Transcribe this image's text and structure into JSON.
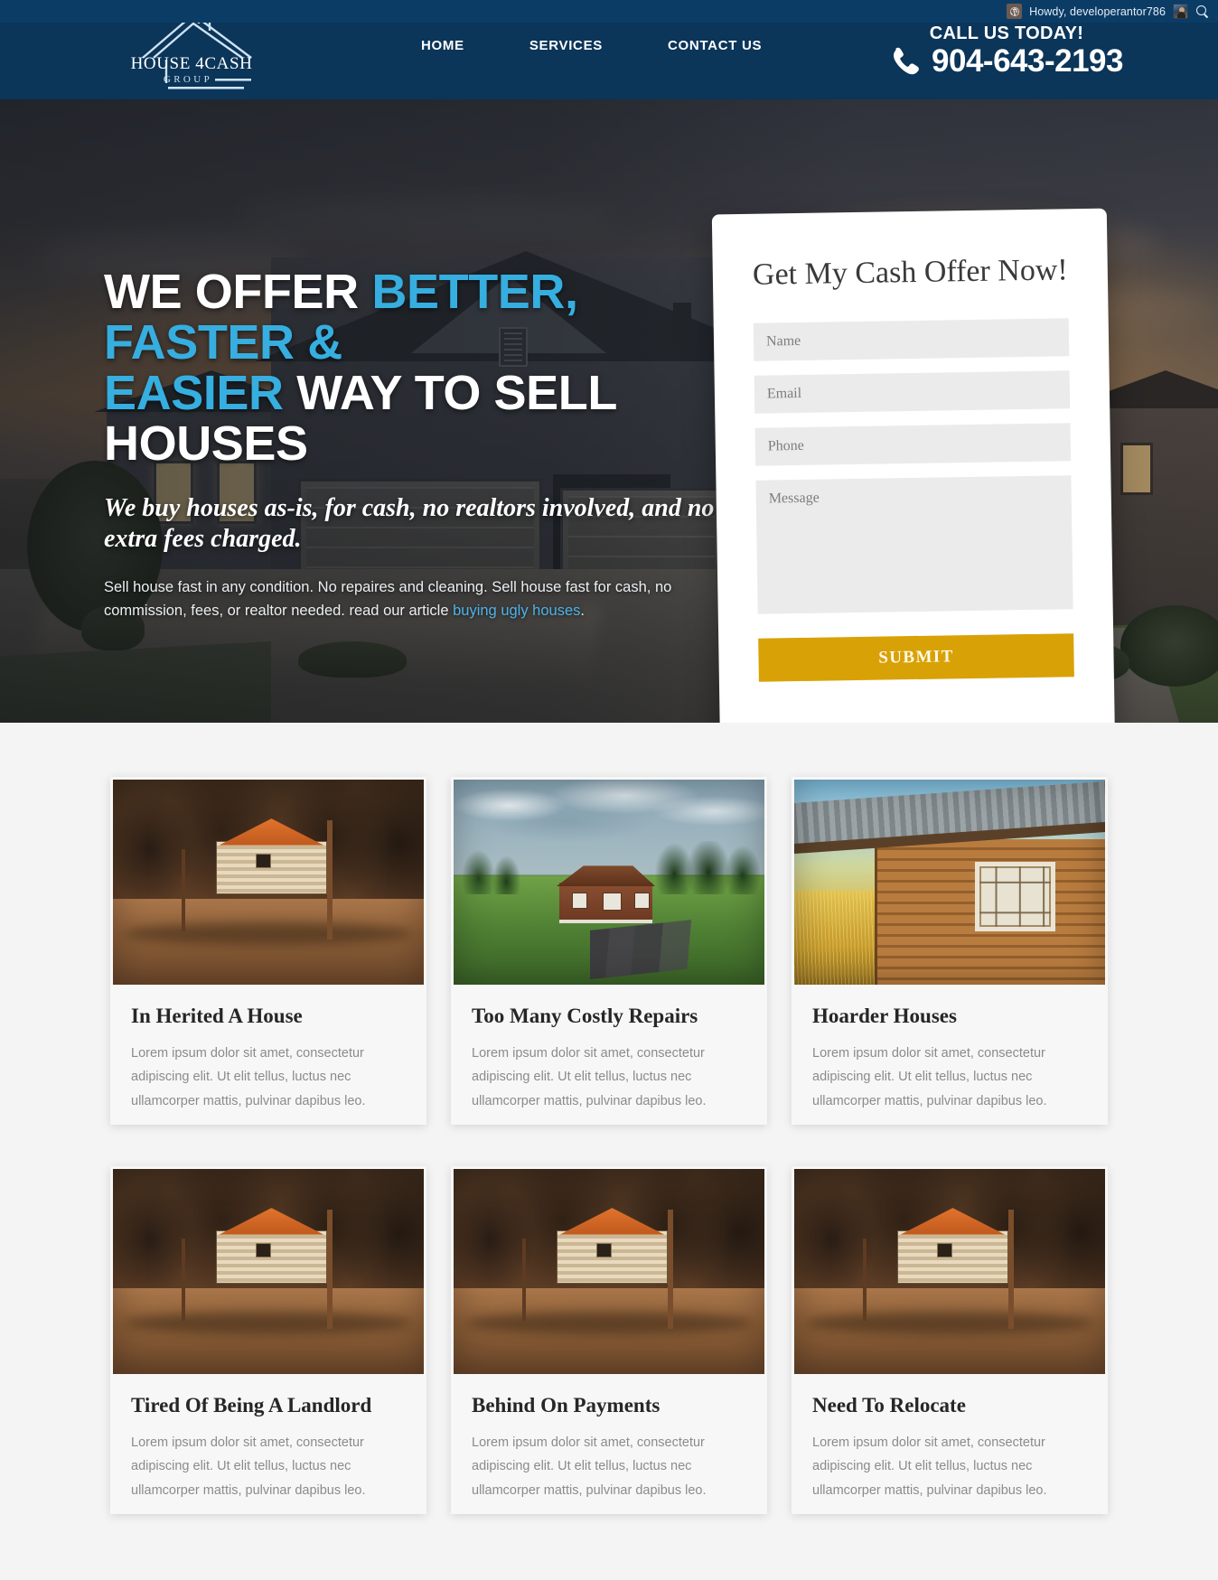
{
  "adminbar": {
    "wp_icon": "wordpress-icon",
    "howdy": "Howdy, developerantor786",
    "avatar": "user-avatar",
    "search_icon": "search-icon"
  },
  "header": {
    "logo": {
      "line1": "HOUSE 4CASH",
      "line2": "GROUP",
      "icon": "house-outline-icon"
    },
    "nav": [
      {
        "label": "HOME"
      },
      {
        "label": "SERVICES"
      },
      {
        "label": "CONTACT US"
      }
    ],
    "call": {
      "label": "CALL US TODAY!",
      "phone_icon": "phone-icon",
      "number": "904-643-2193"
    },
    "colors": {
      "background": "#0b3559",
      "adminbar": "#0b3c66"
    }
  },
  "hero": {
    "headline": {
      "part1": "WE OFFER ",
      "accent1": "BETTER, FASTER &",
      "accent2": "EASIER",
      "part2": " WAY TO SELL HOUSES"
    },
    "subheadline": "We buy houses as-is, for cash, no realtors involved, and no extra fees charged.",
    "paragraph_before": "Sell house fast in any condition. No repaires and cleaning. Sell house fast for cash, no commission, fees, or realtor needed. read our article ",
    "paragraph_link": "buying ugly houses",
    "paragraph_after": ".",
    "colors": {
      "accent": "#36aee0"
    }
  },
  "form": {
    "title": "Get My Cash Offer Now!",
    "fields": [
      {
        "name": "name",
        "placeholder": "Name"
      },
      {
        "name": "email",
        "placeholder": "Email"
      },
      {
        "name": "phone",
        "placeholder": "Phone"
      }
    ],
    "message_placeholder": "Message",
    "submit_label": "SUBMIT",
    "colors": {
      "submit": "#d8a206",
      "field": "#ebebeb"
    }
  },
  "cards": [
    {
      "title": "In Herited A House",
      "text": "Lorem ipsum dolor sit amet, consectetur adipiscing elit. Ut elit tellus, luctus nec ullamcorper mattis, pulvinar dapibus leo.",
      "image": "log-cabin-dirt-road-photo"
    },
    {
      "title": "Too Many Costly Repairs",
      "text": "Lorem ipsum dolor sit amet, consectetur adipiscing elit. Ut elit tellus, luctus nec ullamcorper mattis, pulvinar dapibus leo.",
      "image": "red-house-green-lawn-photo"
    },
    {
      "title": "Hoarder Houses",
      "text": "Lorem ipsum dolor sit amet, consectetur adipiscing elit. Ut elit tellus, luctus nec ullamcorper mattis, pulvinar dapibus leo.",
      "image": "wooden-cabin-window-field-photo"
    },
    {
      "title": "Tired Of Being A Landlord",
      "text": "Lorem ipsum dolor sit amet, consectetur adipiscing elit. Ut elit tellus, luctus nec ullamcorper mattis, pulvinar dapibus leo.",
      "image": "log-cabin-dirt-road-photo"
    },
    {
      "title": "Behind On Payments",
      "text": "Lorem ipsum dolor sit amet, consectetur adipiscing elit. Ut elit tellus, luctus nec ullamcorper mattis, pulvinar dapibus leo.",
      "image": "log-cabin-dirt-road-photo"
    },
    {
      "title": "Need To Relocate",
      "text": "Lorem ipsum dolor sit amet, consectetur adipiscing elit. Ut elit tellus, luctus nec ullamcorper mattis, pulvinar dapibus leo.",
      "image": "log-cabin-dirt-road-photo"
    }
  ]
}
